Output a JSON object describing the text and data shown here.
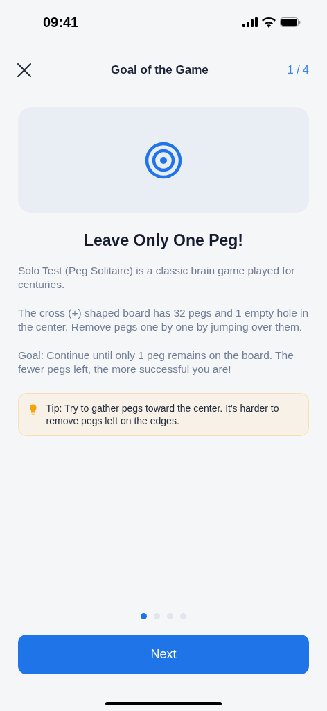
{
  "status_bar": {
    "time": "09:41"
  },
  "header": {
    "title": "Goal of the Game",
    "progress": "1 / 4"
  },
  "heading": "Leave Only One Peg!",
  "paragraphs": [
    "Solo Test (Peg Solitaire) is a classic brain game played for centuries.",
    "The cross (+) shaped board has 32 pegs and 1 empty hole in the center. Remove pegs one by one by jumping over them.",
    "Goal: Continue until only 1 peg remains on the board. The fewer pegs left, the more successful you are!"
  ],
  "tip": "Tip: Try to gather pegs toward the center. It's harder to remove pegs left on the edges.",
  "pages": [
    {
      "selected": true
    },
    {
      "selected": false
    },
    {
      "selected": false
    },
    {
      "selected": false
    }
  ],
  "next_button": "Next"
}
